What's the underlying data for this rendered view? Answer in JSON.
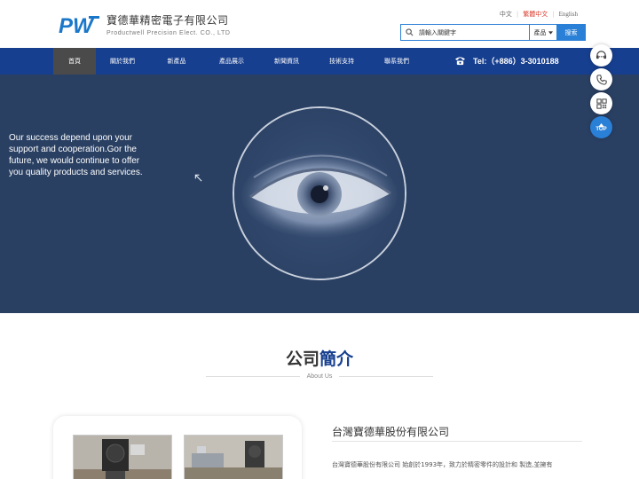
{
  "header": {
    "logo_text": "PW",
    "company_name": "寶德華精密電子有限公司",
    "company_sub": "Productwell Precision Elect. CO., LTD",
    "languages": [
      {
        "label": "中文",
        "active": false
      },
      {
        "label": "繁體中文",
        "active": true
      },
      {
        "label": "English",
        "active": false
      }
    ],
    "search": {
      "value": "請輸入關鍵字",
      "category": "產品",
      "button": "搜索"
    }
  },
  "nav": {
    "items": [
      "首頁",
      "關於我們",
      "新產品",
      "產品展示",
      "新聞資訊",
      "技術支持",
      "聯系我們"
    ],
    "active_index": 0,
    "tel_label": "Tel:（+886）3-3010188"
  },
  "hero": {
    "text": "Our success depend upon your support and cooperation.Gor the future, we would continue to offer you quality products and services."
  },
  "float_buttons": {
    "top_label": "TOP"
  },
  "about": {
    "title_part1": "公司",
    "title_part2": "簡介",
    "subtitle": "About Us",
    "company_name": "台灣寶德華股份有限公司",
    "description": "台灣寶德華股份有限公司 始創於1993年，致力於精密零件的設計和 製造,並擁有"
  },
  "colors": {
    "nav_bg": "#173f8f",
    "hero_bg": "#2a4063",
    "accent_blue": "#2a7fd6",
    "lang_active": "#d93a2b"
  }
}
